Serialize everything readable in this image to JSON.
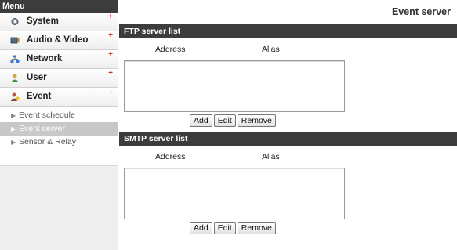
{
  "sidebar": {
    "header": "Menu",
    "items": [
      {
        "label": "System",
        "icon": "system-icon",
        "marker": "+"
      },
      {
        "label": "Audio & Video",
        "icon": "audio-video-icon",
        "marker": "+"
      },
      {
        "label": "Network",
        "icon": "network-icon",
        "marker": "+"
      },
      {
        "label": "User",
        "icon": "user-icon",
        "marker": "+"
      },
      {
        "label": "Event",
        "icon": "event-icon",
        "marker": "-"
      }
    ],
    "sub_items": [
      {
        "label": "Event schedule",
        "active": false
      },
      {
        "label": "Event server",
        "active": true
      },
      {
        "label": "Sensor & Relay",
        "active": false
      }
    ]
  },
  "main": {
    "title": "Event server",
    "ftp": {
      "header": "FTP server list",
      "col_address": "Address",
      "col_alias": "Alias",
      "add": "Add",
      "edit": "Edit",
      "remove": "Remove"
    },
    "smtp": {
      "header": "SMTP server list",
      "col_address": "Address",
      "col_alias": "Alias",
      "add": "Add",
      "edit": "Edit",
      "remove": "Remove"
    }
  },
  "colors": {
    "header_bg": "#3c3c3c",
    "active_sub_bg": "#c8c8c8",
    "marker": "#c0392b"
  }
}
